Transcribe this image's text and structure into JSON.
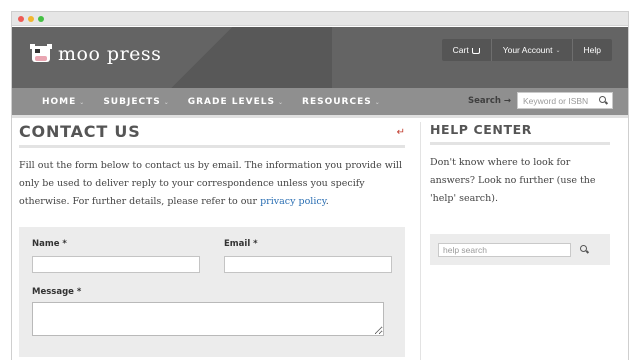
{
  "brand": {
    "name": "moo press"
  },
  "topbar": {
    "cart": "Cart",
    "account": "Your Account",
    "help": "Help"
  },
  "nav": {
    "items": [
      {
        "label": "HOME"
      },
      {
        "label": "SUBJECTS"
      },
      {
        "label": "GRADE LEVELS"
      },
      {
        "label": "RESOURCES"
      }
    ],
    "search_label": "Search →",
    "search_placeholder": "Keyword or ISBN"
  },
  "main": {
    "title": "CONTACT US",
    "intro_text": "Fill out the form below to contact us by email. The information you provide will only be used to deliver reply to your correspondence unless you specify otherwise. For further details, please refer to our ",
    "intro_link": "privacy policy",
    "intro_end": ".",
    "form": {
      "name_label": "Name *",
      "name_value": "",
      "email_label": "Email *",
      "email_value": "",
      "message_label": "Message *",
      "message_value": ""
    }
  },
  "sidebar": {
    "title": "HELP CENTER",
    "text": "Don't know where to look for answers? Look no further (use the 'help' search).",
    "search_placeholder": "help search"
  }
}
